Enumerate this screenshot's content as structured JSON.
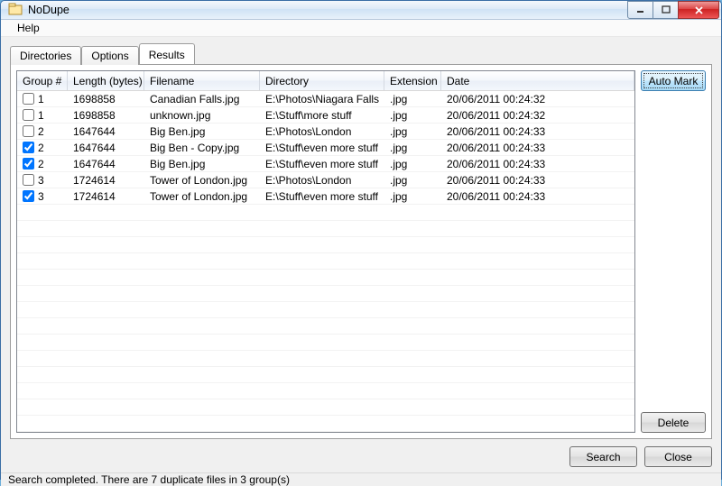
{
  "window": {
    "title": "NoDupe"
  },
  "menu": {
    "help": "Help"
  },
  "tabs": [
    {
      "label": "Directories",
      "active": false
    },
    {
      "label": "Options",
      "active": false
    },
    {
      "label": "Results",
      "active": true
    }
  ],
  "columns": {
    "group": "Group #",
    "length": "Length (bytes)",
    "filename": "Filename",
    "directory": "Directory",
    "extension": "Extension",
    "date": "Date"
  },
  "rows": [
    {
      "checked": false,
      "group": "1",
      "length": "1698858",
      "filename": "Canadian Falls.jpg",
      "directory": "E:\\Photos\\Niagara Falls",
      "extension": ".jpg",
      "date": "20/06/2011 00:24:32"
    },
    {
      "checked": false,
      "group": "1",
      "length": "1698858",
      "filename": "unknown.jpg",
      "directory": "E:\\Stuff\\more stuff",
      "extension": ".jpg",
      "date": "20/06/2011 00:24:32"
    },
    {
      "checked": false,
      "group": "2",
      "length": "1647644",
      "filename": "Big Ben.jpg",
      "directory": "E:\\Photos\\London",
      "extension": ".jpg",
      "date": "20/06/2011 00:24:33"
    },
    {
      "checked": true,
      "group": "2",
      "length": "1647644",
      "filename": "Big Ben - Copy.jpg",
      "directory": "E:\\Stuff\\even more stuff",
      "extension": ".jpg",
      "date": "20/06/2011 00:24:33"
    },
    {
      "checked": true,
      "group": "2",
      "length": "1647644",
      "filename": "Big Ben.jpg",
      "directory": "E:\\Stuff\\even more stuff",
      "extension": ".jpg",
      "date": "20/06/2011 00:24:33"
    },
    {
      "checked": false,
      "group": "3",
      "length": "1724614",
      "filename": "Tower of London.jpg",
      "directory": "E:\\Photos\\London",
      "extension": ".jpg",
      "date": "20/06/2011 00:24:33"
    },
    {
      "checked": true,
      "group": "3",
      "length": "1724614",
      "filename": "Tower of London.jpg",
      "directory": "E:\\Stuff\\even more stuff",
      "extension": ".jpg",
      "date": "20/06/2011 00:24:33"
    }
  ],
  "buttons": {
    "automark": "Auto Mark",
    "delete": "Delete",
    "search": "Search",
    "close": "Close"
  },
  "status": "Search completed. There are 7 duplicate files in 3 group(s)"
}
